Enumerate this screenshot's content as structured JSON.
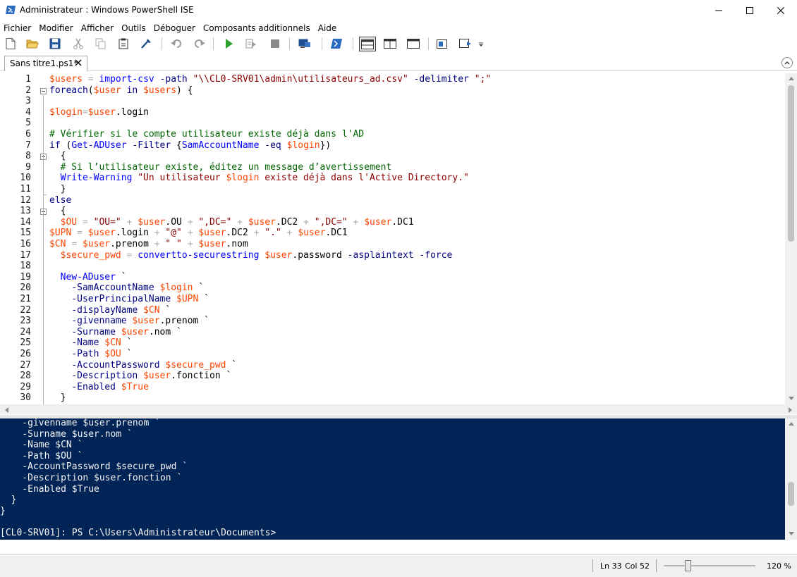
{
  "window": {
    "title": "Administrateur : Windows PowerShell ISE"
  },
  "menu": [
    "Fichier",
    "Modifier",
    "Afficher",
    "Outils",
    "Déboguer",
    "Composants additionnels",
    "Aide"
  ],
  "toolbar_icons": [
    "new-script-icon",
    "open-icon",
    "save-icon",
    "cut-icon",
    "copy-icon",
    "paste-icon",
    "clear-console-icon",
    "undo-icon",
    "redo-icon",
    "run-icon",
    "run-selection-icon",
    "stop-icon",
    "new-remote-tab-icon",
    "start-powershell-icon",
    "layout-script-top-icon",
    "layout-script-right-icon",
    "layout-script-max-icon",
    "show-script-pane-icon",
    "show-commands-addon-icon"
  ],
  "tab": {
    "label": "Sans titre1.ps1*"
  },
  "script": {
    "line_numbers": [
      "1",
      "2",
      "3",
      "4",
      "5",
      "6",
      "7",
      "8",
      "9",
      "10",
      "11",
      "12",
      "13",
      "14",
      "15",
      "16",
      "17",
      "18",
      "19",
      "20",
      "21",
      "22",
      "23",
      "24",
      "25",
      "26",
      "27",
      "28",
      "29",
      "30"
    ],
    "lines": [
      [
        [
          "v",
          "$users"
        ],
        [
          "t",
          " "
        ],
        [
          "o",
          "="
        ],
        [
          "t",
          " "
        ],
        [
          "m",
          "import-csv"
        ],
        [
          "t",
          " "
        ],
        [
          "p",
          "-path"
        ],
        [
          "t",
          " "
        ],
        [
          "s",
          "\"\\\\CL0-SRV01\\admin\\utilisateurs_ad.csv\""
        ],
        [
          "t",
          " "
        ],
        [
          "p",
          "-delimiter"
        ],
        [
          "t",
          " "
        ],
        [
          "s",
          "\";\""
        ]
      ],
      [
        [
          "k",
          "foreach"
        ],
        [
          "t",
          "("
        ],
        [
          "v",
          "$user"
        ],
        [
          "t",
          " "
        ],
        [
          "k",
          "in"
        ],
        [
          "t",
          " "
        ],
        [
          "v",
          "$users"
        ],
        [
          "t",
          ") {"
        ]
      ],
      [],
      [
        [
          "v",
          "$login"
        ],
        [
          "o",
          "="
        ],
        [
          "v",
          "$user"
        ],
        [
          "t",
          "."
        ],
        [
          "t",
          "login"
        ]
      ],
      [],
      [
        [
          "c",
          "# Vérifier si le compte utilisateur existe déjà dans l'AD"
        ]
      ],
      [
        [
          "k",
          "if"
        ],
        [
          "t",
          " ("
        ],
        [
          "m",
          "Get-ADUser"
        ],
        [
          "t",
          " "
        ],
        [
          "p",
          "-Filter"
        ],
        [
          "t",
          " {"
        ],
        [
          "m",
          "SamAccountName"
        ],
        [
          "t",
          " "
        ],
        [
          "p",
          "-eq"
        ],
        [
          "t",
          " "
        ],
        [
          "v",
          "$login"
        ],
        [
          "t",
          "})"
        ]
      ],
      [
        [
          "t",
          "  {"
        ]
      ],
      [
        [
          "c",
          "  # Si l’utilisateur existe, éditez un message d’avertissement"
        ]
      ],
      [
        [
          "t",
          "  "
        ],
        [
          "m",
          "Write-Warning"
        ],
        [
          "t",
          " "
        ],
        [
          "s",
          "\"Un utilisateur "
        ],
        [
          "v",
          "$login"
        ],
        [
          "s",
          " existe déjà dans l'Active Directory.\""
        ]
      ],
      [
        [
          "t",
          "  }"
        ]
      ],
      [
        [
          "k",
          "else"
        ]
      ],
      [
        [
          "t",
          "  {"
        ]
      ],
      [
        [
          "t",
          "  "
        ],
        [
          "v",
          "$OU"
        ],
        [
          "t",
          " "
        ],
        [
          "o",
          "="
        ],
        [
          "t",
          " "
        ],
        [
          "s",
          "\"OU=\""
        ],
        [
          "t",
          " "
        ],
        [
          "o",
          "+"
        ],
        [
          "t",
          " "
        ],
        [
          "v",
          "$user"
        ],
        [
          "t",
          ".OU "
        ],
        [
          "o",
          "+"
        ],
        [
          "t",
          " "
        ],
        [
          "s",
          "\",DC=\""
        ],
        [
          "t",
          " "
        ],
        [
          "o",
          "+"
        ],
        [
          "t",
          " "
        ],
        [
          "v",
          "$user"
        ],
        [
          "t",
          ".DC2 "
        ],
        [
          "o",
          "+"
        ],
        [
          "t",
          " "
        ],
        [
          "s",
          "\",DC=\""
        ],
        [
          "t",
          " "
        ],
        [
          "o",
          "+"
        ],
        [
          "t",
          " "
        ],
        [
          "v",
          "$user"
        ],
        [
          "t",
          ".DC1"
        ]
      ],
      [
        [
          "v",
          "$UPN"
        ],
        [
          "t",
          " "
        ],
        [
          "o",
          "="
        ],
        [
          "t",
          " "
        ],
        [
          "v",
          "$user"
        ],
        [
          "t",
          ".login "
        ],
        [
          "o",
          "+"
        ],
        [
          "t",
          " "
        ],
        [
          "s",
          "\"@\""
        ],
        [
          "t",
          " "
        ],
        [
          "o",
          "+"
        ],
        [
          "t",
          " "
        ],
        [
          "v",
          "$user"
        ],
        [
          "t",
          ".DC2 "
        ],
        [
          "o",
          "+"
        ],
        [
          "t",
          " "
        ],
        [
          "s",
          "\".\""
        ],
        [
          "t",
          " "
        ],
        [
          "o",
          "+"
        ],
        [
          "t",
          " "
        ],
        [
          "v",
          "$user"
        ],
        [
          "t",
          ".DC1"
        ]
      ],
      [
        [
          "v",
          "$CN"
        ],
        [
          "t",
          " "
        ],
        [
          "o",
          "="
        ],
        [
          "t",
          " "
        ],
        [
          "v",
          "$user"
        ],
        [
          "t",
          ".prenom "
        ],
        [
          "o",
          "+"
        ],
        [
          "t",
          " "
        ],
        [
          "s",
          "\" \""
        ],
        [
          "t",
          " "
        ],
        [
          "o",
          "+"
        ],
        [
          "t",
          " "
        ],
        [
          "v",
          "$user"
        ],
        [
          "t",
          ".nom"
        ]
      ],
      [
        [
          "t",
          "  "
        ],
        [
          "v",
          "$secure_pwd"
        ],
        [
          "t",
          " "
        ],
        [
          "o",
          "="
        ],
        [
          "t",
          " "
        ],
        [
          "m",
          "convertto-securestring"
        ],
        [
          "t",
          " "
        ],
        [
          "v",
          "$user"
        ],
        [
          "t",
          ".password "
        ],
        [
          "p",
          "-asplaintext"
        ],
        [
          "t",
          " "
        ],
        [
          "p",
          "-force"
        ]
      ],
      [],
      [
        [
          "t",
          "  "
        ],
        [
          "m",
          "New-ADuser"
        ],
        [
          "t",
          " `"
        ]
      ],
      [
        [
          "t",
          "    "
        ],
        [
          "p",
          "-SamAccountName"
        ],
        [
          "t",
          " "
        ],
        [
          "v",
          "$login"
        ],
        [
          "t",
          " `"
        ]
      ],
      [
        [
          "t",
          "    "
        ],
        [
          "p",
          "-UserPrincipalName"
        ],
        [
          "t",
          " "
        ],
        [
          "v",
          "$UPN"
        ],
        [
          "t",
          " `"
        ]
      ],
      [
        [
          "t",
          "    "
        ],
        [
          "p",
          "-displayName"
        ],
        [
          "t",
          " "
        ],
        [
          "v",
          "$CN"
        ],
        [
          "t",
          " `"
        ]
      ],
      [
        [
          "t",
          "    "
        ],
        [
          "p",
          "-givenname"
        ],
        [
          "t",
          " "
        ],
        [
          "v",
          "$user"
        ],
        [
          "t",
          ".prenom `"
        ]
      ],
      [
        [
          "t",
          "    "
        ],
        [
          "p",
          "-Surname"
        ],
        [
          "t",
          " "
        ],
        [
          "v",
          "$user"
        ],
        [
          "t",
          ".nom `"
        ]
      ],
      [
        [
          "t",
          "    "
        ],
        [
          "p",
          "-Name"
        ],
        [
          "t",
          " "
        ],
        [
          "v",
          "$CN"
        ],
        [
          "t",
          " `"
        ]
      ],
      [
        [
          "t",
          "    "
        ],
        [
          "p",
          "-Path"
        ],
        [
          "t",
          " "
        ],
        [
          "v",
          "$OU"
        ],
        [
          "t",
          " `"
        ]
      ],
      [
        [
          "t",
          "    "
        ],
        [
          "p",
          "-AccountPassword"
        ],
        [
          "t",
          " "
        ],
        [
          "v",
          "$secure_pwd"
        ],
        [
          "t",
          " `"
        ]
      ],
      [
        [
          "t",
          "    "
        ],
        [
          "p",
          "-Description"
        ],
        [
          "t",
          " "
        ],
        [
          "v",
          "$user"
        ],
        [
          "t",
          ".fonction `"
        ]
      ],
      [
        [
          "t",
          "    "
        ],
        [
          "p",
          "-Enabled"
        ],
        [
          "t",
          " "
        ],
        [
          "v",
          "$True"
        ]
      ],
      [
        [
          "t",
          "  }"
        ]
      ]
    ]
  },
  "console": {
    "lines": [
      "    -givenname $user.prenom `",
      "    -Surname $user.nom `",
      "    -Name $CN `",
      "    -Path $OU `",
      "    -AccountPassword $secure_pwd `",
      "    -Description $user.fonction `",
      "    -Enabled $True",
      "  }",
      "}",
      "",
      "[CL0-SRV01]: PS C:\\Users\\Administrateur\\Documents>"
    ]
  },
  "status": {
    "line": "Ln 33",
    "col": "Col 52",
    "zoom": "120 %",
    "zoom_value": 120
  },
  "colors": {
    "console_bg": "#012456",
    "variable": "#ff4500",
    "comment": "#006400",
    "string": "#8b0000",
    "keyword": "#00008b",
    "command": "#0000ff",
    "parameter": "#000080",
    "operator": "#a9a9a9"
  }
}
